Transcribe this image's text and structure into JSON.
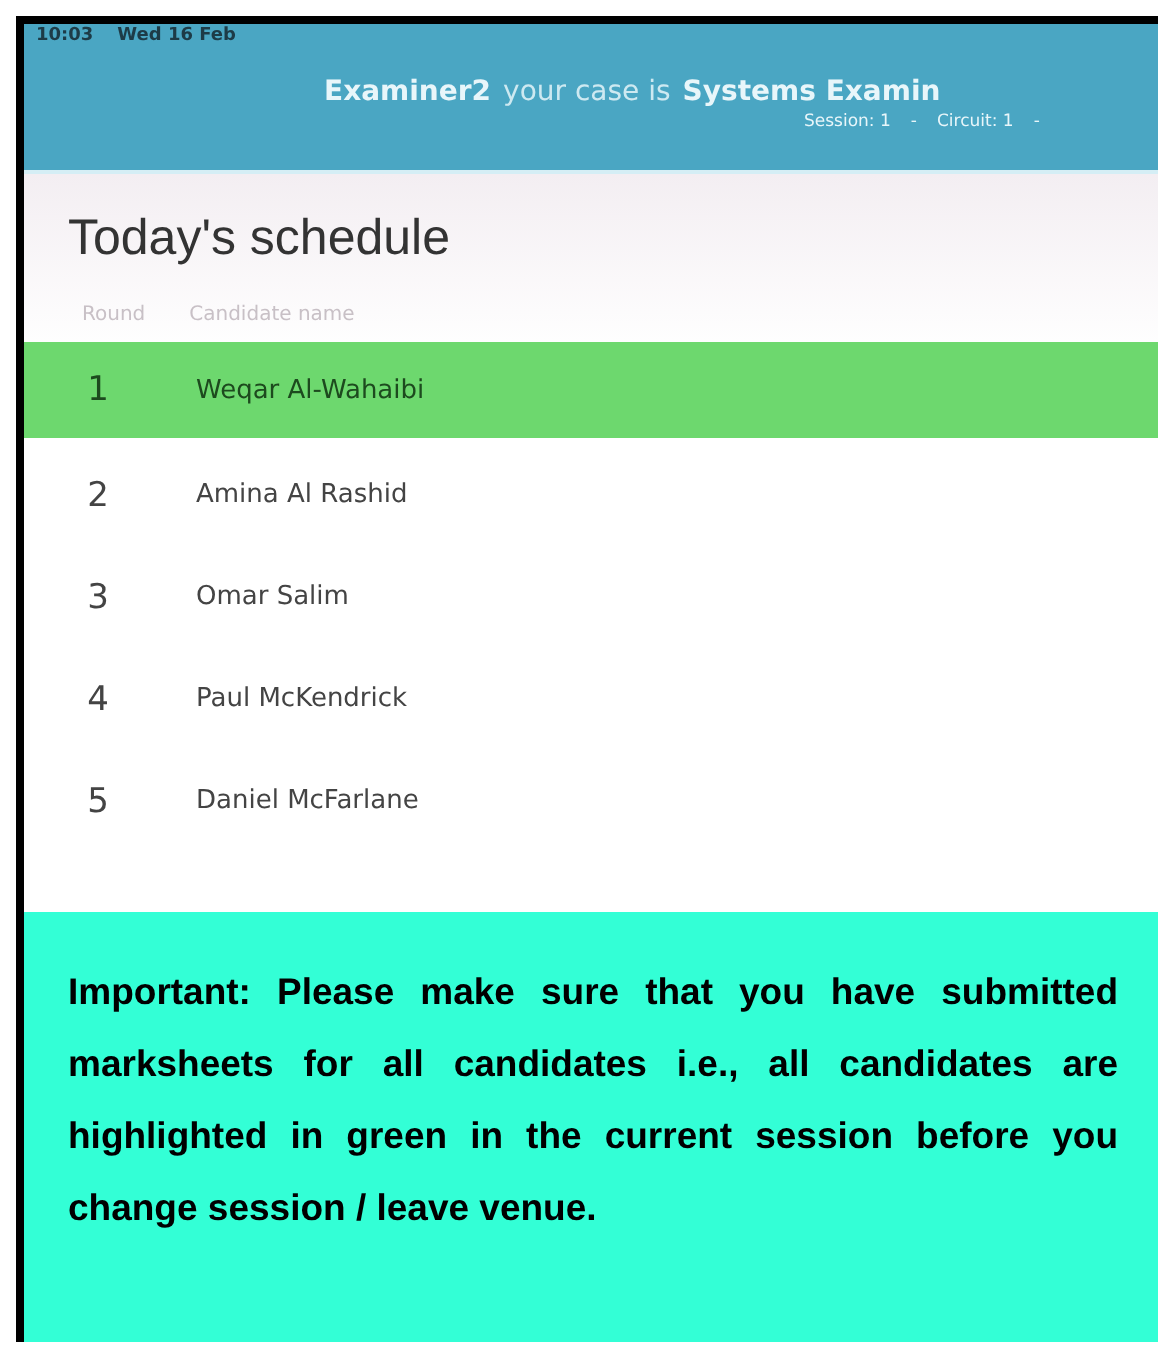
{
  "status_bar": {
    "time": "10:03",
    "date": "Wed 16 Feb"
  },
  "header": {
    "examiner": "Examiner2",
    "intro": "your case is",
    "case": "Systems Examin",
    "session": "Session: 1",
    "separator": "-",
    "circuit": "Circuit: 1",
    "trailing": "-"
  },
  "title": "Today's schedule",
  "table": {
    "columns": [
      "Round",
      "Candidate name"
    ],
    "rows": [
      {
        "round": "1",
        "name": "Weqar Al-Wahaibi",
        "highlighted": true
      },
      {
        "round": "2",
        "name": "Amina Al Rashid",
        "highlighted": false
      },
      {
        "round": "3",
        "name": "Omar Salim",
        "highlighted": false
      },
      {
        "round": "4",
        "name": "Paul McKendrick",
        "highlighted": false
      },
      {
        "round": "5",
        "name": "Daniel McFarlane",
        "highlighted": false
      }
    ]
  },
  "notice": "Important: Please make sure that you have submitted marksheets for all candidates i.e., all candidates are highlighted in green in the current session before you change session / leave venue."
}
